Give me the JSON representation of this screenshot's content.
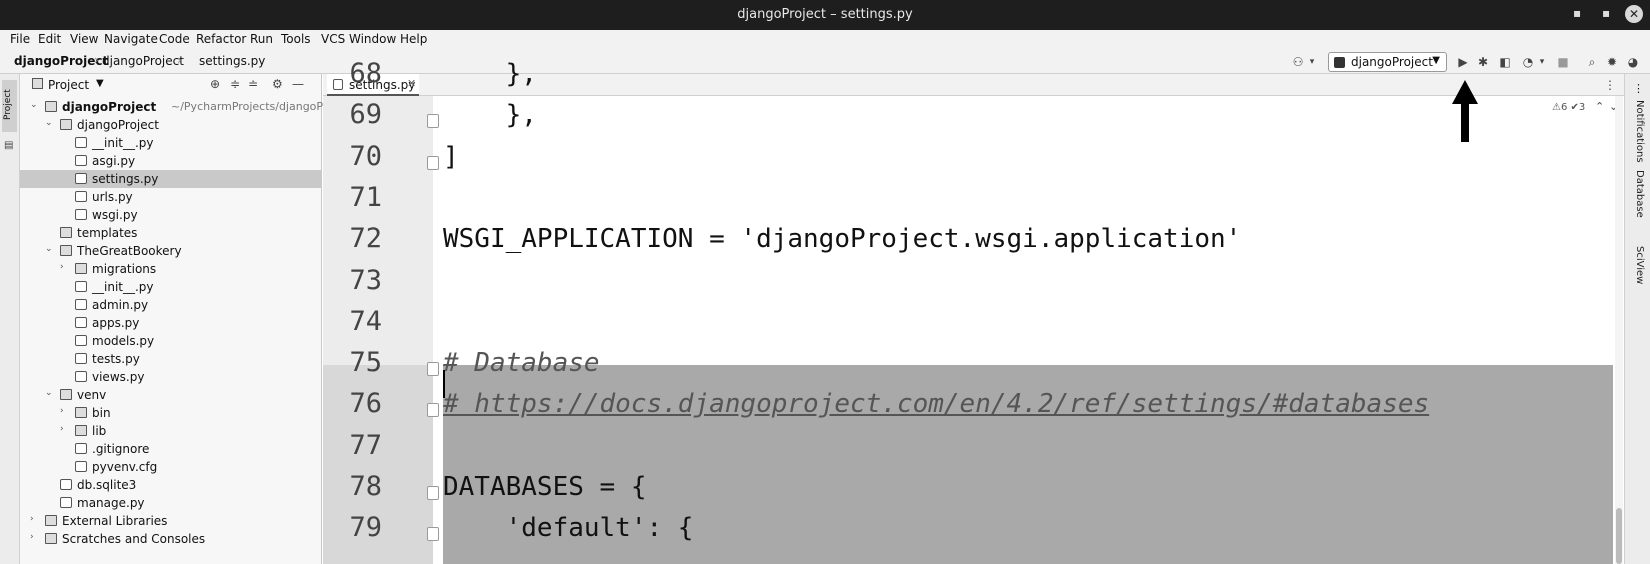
{
  "window": {
    "title": "djangoProject – settings.py",
    "minimize": "▪",
    "maximize": "▪",
    "close": "✕"
  },
  "menu": [
    "File",
    "Edit",
    "View",
    "Navigate",
    "Code",
    "Refactor",
    "Run",
    "Tools",
    "VCS",
    "Window",
    "Help"
  ],
  "breadcrumb": [
    "djangoProject",
    "djangoProject",
    "settings.py"
  ],
  "toolbar": {
    "run_config": "djangoProject",
    "icons": [
      "user-icon",
      "run-icon",
      "debug-icon",
      "coverage-icon",
      "profile-icon",
      "stop-icon",
      "search-icon",
      "settings-icon",
      "plugin-icon"
    ]
  },
  "left_tool_tabs": [
    "Project"
  ],
  "project_panel": {
    "title": "Project",
    "tree": [
      {
        "label": "djangoProject",
        "path": "~/PycharmProjects/djangoProject",
        "type": "folder",
        "depth": 0,
        "expanded": true,
        "bold": true
      },
      {
        "label": "djangoProject",
        "type": "folder",
        "depth": 1,
        "expanded": true
      },
      {
        "label": "__init__.py",
        "type": "file",
        "depth": 2
      },
      {
        "label": "asgi.py",
        "type": "file",
        "depth": 2
      },
      {
        "label": "settings.py",
        "type": "file",
        "depth": 2,
        "selected": true
      },
      {
        "label": "urls.py",
        "type": "file",
        "depth": 2
      },
      {
        "label": "wsgi.py",
        "type": "file",
        "depth": 2
      },
      {
        "label": "templates",
        "type": "folder",
        "depth": 1
      },
      {
        "label": "TheGreatBookery",
        "type": "folder",
        "depth": 1,
        "expanded": true
      },
      {
        "label": "migrations",
        "type": "folder",
        "depth": 2,
        "collapsed": true
      },
      {
        "label": "__init__.py",
        "type": "file",
        "depth": 2
      },
      {
        "label": "admin.py",
        "type": "file",
        "depth": 2
      },
      {
        "label": "apps.py",
        "type": "file",
        "depth": 2
      },
      {
        "label": "models.py",
        "type": "file",
        "depth": 2
      },
      {
        "label": "tests.py",
        "type": "file",
        "depth": 2
      },
      {
        "label": "views.py",
        "type": "file",
        "depth": 2
      },
      {
        "label": "venv",
        "type": "folder",
        "depth": 1,
        "expanded": true
      },
      {
        "label": "bin",
        "type": "folder",
        "depth": 2,
        "collapsed": true
      },
      {
        "label": "lib",
        "type": "folder",
        "depth": 2,
        "collapsed": true
      },
      {
        "label": ".gitignore",
        "type": "file",
        "depth": 2
      },
      {
        "label": "pyvenv.cfg",
        "type": "file",
        "depth": 2
      },
      {
        "label": "db.sqlite3",
        "type": "file",
        "depth": 1
      },
      {
        "label": "manage.py",
        "type": "file",
        "depth": 1
      },
      {
        "label": "External Libraries",
        "type": "library",
        "depth": 0,
        "collapsed": true
      },
      {
        "label": "Scratches and Consoles",
        "type": "scratch",
        "depth": 0,
        "collapsed": true
      }
    ]
  },
  "editor": {
    "tab": "settings.py",
    "inspections": "⚠6 ✔3",
    "lines": [
      {
        "no": "68",
        "text": "    },",
        "style": "code"
      },
      {
        "no": "69",
        "text": "    },",
        "style": "code"
      },
      {
        "no": "70",
        "text": "]",
        "style": "code"
      },
      {
        "no": "71",
        "text": "",
        "style": "code"
      },
      {
        "no": "72",
        "text": "WSGI_APPLICATION = 'djangoProject.wsgi.application'",
        "style": "code"
      },
      {
        "no": "73",
        "text": "",
        "style": "code"
      },
      {
        "no": "74",
        "text": "",
        "style": "code"
      },
      {
        "no": "75",
        "text": "# Database",
        "style": "comment"
      },
      {
        "no": "76",
        "text": "# https://docs.djangoproject.com/en/4.2/ref/settings/#databases",
        "style": "link"
      },
      {
        "no": "77",
        "text": "",
        "style": "code"
      },
      {
        "no": "78",
        "text": "DATABASES = {",
        "style": "code"
      },
      {
        "no": "79",
        "text": "    'default': {",
        "style": "code"
      }
    ]
  },
  "right_tool_tabs": [
    "Notifications",
    "Database",
    "SciView"
  ]
}
